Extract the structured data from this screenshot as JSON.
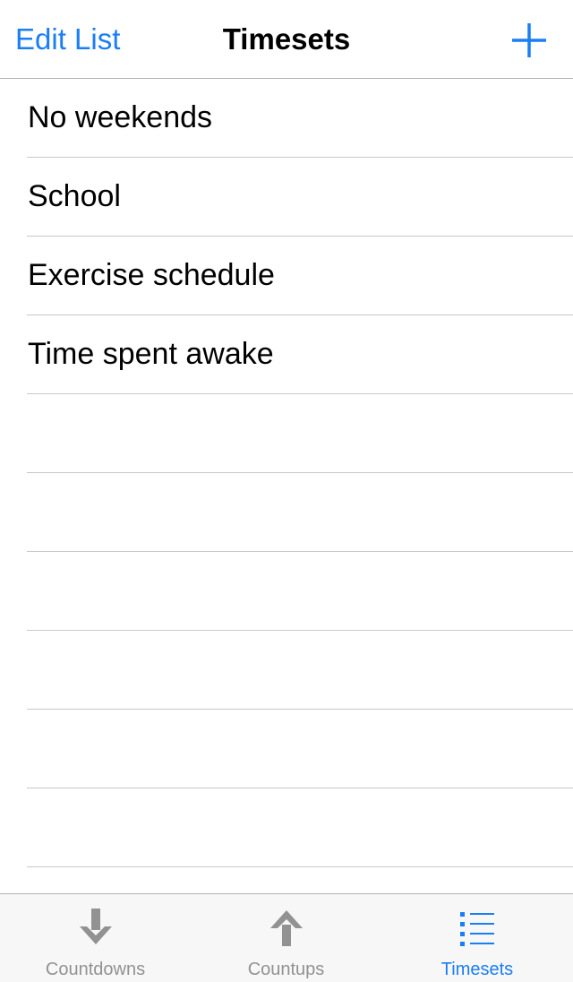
{
  "navbar": {
    "edit_label": "Edit List",
    "title": "Timesets",
    "add_icon": "plus-icon"
  },
  "list": {
    "items": [
      {
        "label": "No weekends"
      },
      {
        "label": "School"
      },
      {
        "label": "Exercise schedule"
      },
      {
        "label": "Time spent awake"
      }
    ],
    "empty_rows": 6
  },
  "tabbar": {
    "tabs": [
      {
        "label": "Countdowns",
        "icon": "arrow-down-icon",
        "active": false
      },
      {
        "label": "Countups",
        "icon": "arrow-up-icon",
        "active": false
      },
      {
        "label": "Timesets",
        "icon": "list-icon",
        "active": true
      }
    ]
  },
  "colors": {
    "accent": "#1a7ef5",
    "inactive": "#929292",
    "separator": "#c8c7cc",
    "tabbar_bg": "#f7f7f7"
  }
}
